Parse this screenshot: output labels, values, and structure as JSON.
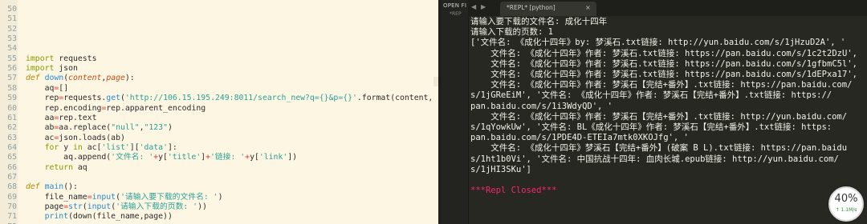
{
  "editor": {
    "lines": [
      {
        "num": "50",
        "parts": []
      },
      {
        "num": "51",
        "parts": []
      },
      {
        "num": "52",
        "parts": []
      },
      {
        "num": "53",
        "parts": []
      },
      {
        "num": "54",
        "parts": []
      },
      {
        "num": "55",
        "parts": [
          {
            "c": "kw",
            "t": "import"
          },
          {
            "c": "plain",
            "t": " requests"
          }
        ]
      },
      {
        "num": "56",
        "parts": [
          {
            "c": "kw",
            "t": "import"
          },
          {
            "c": "plain",
            "t": " json"
          }
        ]
      },
      {
        "num": "57",
        "parts": [
          {
            "c": "kw2",
            "t": "def"
          },
          {
            "c": "plain",
            "t": " "
          },
          {
            "c": "fn",
            "t": "down"
          },
          {
            "c": "plain",
            "t": "("
          },
          {
            "c": "param",
            "t": "content"
          },
          {
            "c": "plain",
            "t": ","
          },
          {
            "c": "param",
            "t": "page"
          },
          {
            "c": "plain",
            "t": "):"
          }
        ]
      },
      {
        "num": "58",
        "parts": [
          {
            "c": "plain",
            "t": "    aq"
          },
          {
            "c": "op",
            "t": "="
          },
          {
            "c": "plain",
            "t": "[]"
          }
        ]
      },
      {
        "num": "59",
        "parts": [
          {
            "c": "plain",
            "t": "    rep"
          },
          {
            "c": "op",
            "t": "="
          },
          {
            "c": "plain",
            "t": "requests."
          },
          {
            "c": "fn",
            "t": "get"
          },
          {
            "c": "plain",
            "t": "("
          },
          {
            "c": "str",
            "t": "'http://106.15.195.249:8011/search_new?q={}&p={}'"
          },
          {
            "c": "plain",
            "t": ".format(content,"
          }
        ]
      },
      {
        "num": "60",
        "parts": [
          {
            "c": "plain",
            "t": "    rep.encoding"
          },
          {
            "c": "op",
            "t": "="
          },
          {
            "c": "plain",
            "t": "rep.apparent_encoding"
          }
        ]
      },
      {
        "num": "61",
        "parts": [
          {
            "c": "plain",
            "t": "    aa"
          },
          {
            "c": "op",
            "t": "="
          },
          {
            "c": "plain",
            "t": "rep.text"
          }
        ]
      },
      {
        "num": "62",
        "parts": [
          {
            "c": "plain",
            "t": "    ab"
          },
          {
            "c": "op",
            "t": "="
          },
          {
            "c": "plain",
            "t": "aa.replace("
          },
          {
            "c": "str",
            "t": "\"null\""
          },
          {
            "c": "plain",
            "t": ","
          },
          {
            "c": "str",
            "t": "\"123\""
          },
          {
            "c": "plain",
            "t": ")"
          }
        ]
      },
      {
        "num": "63",
        "parts": [
          {
            "c": "plain",
            "t": "    ac"
          },
          {
            "c": "op",
            "t": "="
          },
          {
            "c": "plain",
            "t": "json.loads(ab)"
          }
        ]
      },
      {
        "num": "64",
        "parts": [
          {
            "c": "plain",
            "t": "    "
          },
          {
            "c": "kw",
            "t": "for"
          },
          {
            "c": "plain",
            "t": " y "
          },
          {
            "c": "kw",
            "t": "in"
          },
          {
            "c": "plain",
            "t": " ac["
          },
          {
            "c": "str",
            "t": "'list'"
          },
          {
            "c": "plain",
            "t": "]["
          },
          {
            "c": "str",
            "t": "'data'"
          },
          {
            "c": "plain",
            "t": "]:"
          }
        ]
      },
      {
        "num": "65",
        "parts": [
          {
            "c": "plain",
            "t": "        aq.append("
          },
          {
            "c": "str",
            "t": "'文件名: '"
          },
          {
            "c": "op",
            "t": "+"
          },
          {
            "c": "plain",
            "t": "y["
          },
          {
            "c": "str",
            "t": "'title'"
          },
          {
            "c": "plain",
            "t": "]"
          },
          {
            "c": "op",
            "t": "+"
          },
          {
            "c": "str",
            "t": "'链接: '"
          },
          {
            "c": "op",
            "t": "+"
          },
          {
            "c": "plain",
            "t": "y["
          },
          {
            "c": "str",
            "t": "'link'"
          },
          {
            "c": "plain",
            "t": "])"
          }
        ]
      },
      {
        "num": "66",
        "parts": [
          {
            "c": "plain",
            "t": "    "
          },
          {
            "c": "kw",
            "t": "return"
          },
          {
            "c": "plain",
            "t": " aq"
          }
        ]
      },
      {
        "num": "67",
        "parts": []
      },
      {
        "num": "68",
        "parts": [
          {
            "c": "kw2",
            "t": "def"
          },
          {
            "c": "plain",
            "t": " "
          },
          {
            "c": "fn",
            "t": "main"
          },
          {
            "c": "plain",
            "t": "():"
          }
        ]
      },
      {
        "num": "69",
        "parts": [
          {
            "c": "plain",
            "t": "    file_name"
          },
          {
            "c": "op",
            "t": "="
          },
          {
            "c": "fn",
            "t": "input"
          },
          {
            "c": "plain",
            "t": "("
          },
          {
            "c": "str",
            "t": "'请输入要下载的文件名: '"
          },
          {
            "c": "plain",
            "t": ")"
          }
        ]
      },
      {
        "num": "70",
        "parts": [
          {
            "c": "plain",
            "t": "    page"
          },
          {
            "c": "op",
            "t": "="
          },
          {
            "c": "fn",
            "t": "str"
          },
          {
            "c": "plain",
            "t": "("
          },
          {
            "c": "fn",
            "t": "input"
          },
          {
            "c": "plain",
            "t": "("
          },
          {
            "c": "str",
            "t": "'请输入下载的页数: '"
          },
          {
            "c": "plain",
            "t": "))"
          }
        ]
      },
      {
        "num": "71",
        "parts": [
          {
            "c": "plain",
            "t": "    "
          },
          {
            "c": "fn",
            "t": "print"
          },
          {
            "c": "plain",
            "t": "(down(file_name,page))"
          }
        ]
      },
      {
        "num": "72",
        "parts": []
      }
    ]
  },
  "panel": {
    "sidebar_title": "OPEN FI",
    "sidebar_sub": "*REP",
    "tab_prev": "◀",
    "tab_next": "▶",
    "tab_label": "*REPL* [python]",
    "tab_close": "×"
  },
  "output": {
    "lines": [
      {
        "text": "请输入要下载的文件名: 成化十四年",
        "closed": false
      },
      {
        "text": "请输入下载的页数: 1",
        "closed": false
      },
      {
        "text": "['文件名: 《成化十四年》by: 梦溪石.txt链接: http://yun.baidu.com/s/1jHzuD2A', '",
        "closed": false
      },
      {
        "text": "    文件名: 《成化十四年》作者: 梦溪石.txt链接: https://pan.baidu.com/s/1c2t2DzU',",
        "closed": false
      },
      {
        "text": "    文件名: 《成化十四年》作者: 梦溪石.txt链接: https://pan.baidu.com/s/1gfbmC5l',",
        "closed": false
      },
      {
        "text": "    文件名: 《成化十四年》作者: 梦溪石.txt链接: https://pan.baidu.com/s/1dEPxa17',",
        "closed": false
      },
      {
        "text": "    文件名: 《成化十四年》作者: 梦溪石【完结+番外】.txt链接: https://pan.baidu.com/",
        "closed": false
      },
      {
        "text": "s/1jGReEiM', '文件名: 《成化十四年》作者: 梦溪石【完结+番外】.txt链接: https://",
        "closed": false
      },
      {
        "text": "pan.baidu.com/s/1i3WdyQD', '",
        "closed": false
      },
      {
        "text": "    文件名: 《成化十四年》作者: 梦溪石【完结+番外】.txt链接: http://yun.baidu.com/",
        "closed": false
      },
      {
        "text": "s/1qYowkUw', '文件名: BL《成化十四年》作者: 梦溪石【完结+番外】.txt链接: https:",
        "closed": false
      },
      {
        "text": "pan.baidu.com/s/1PDE4D-ETEIa7mtk0XKOJfg', '",
        "closed": false
      },
      {
        "text": "    文件名: 《成化十四年》梦溪石【完结+番外】(破案 B L).txt链接: https://pan.baidu",
        "closed": false
      },
      {
        "text": "s/1ht1b0Vi', '文件名: 中国抗战十四年: 血肉长城.epub链接: http://yun.baidu.com/",
        "closed": false
      },
      {
        "text": "s/1jHI3SKu']",
        "closed": false
      },
      {
        "text": "",
        "closed": false
      },
      {
        "text": "***Repl Closed***",
        "closed": true
      }
    ]
  },
  "badge": {
    "percent": "40%",
    "rate": "↑ 1.1M/s"
  }
}
